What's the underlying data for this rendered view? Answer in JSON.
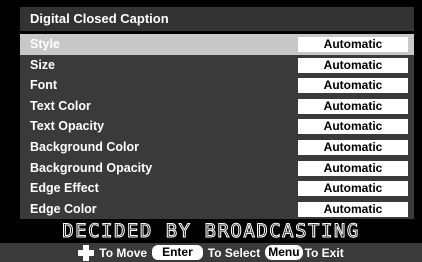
{
  "title": "Digital Closed Caption",
  "menu": {
    "items": [
      {
        "label": "Style",
        "value": "Automatic"
      },
      {
        "label": "Size",
        "value": "Automatic"
      },
      {
        "label": "Font",
        "value": "Automatic"
      },
      {
        "label": "Text Color",
        "value": "Automatic"
      },
      {
        "label": "Text Opacity",
        "value": "Automatic"
      },
      {
        "label": "Background Color",
        "value": "Automatic"
      },
      {
        "label": "Background Opacity",
        "value": "Automatic"
      },
      {
        "label": "Edge Effect",
        "value": "Automatic"
      },
      {
        "label": "Edge Color",
        "value": "Automatic"
      }
    ]
  },
  "banner": "DECIDED BY BROADCASTING",
  "hints": {
    "move_icon": "dpad-icon",
    "move_label": "To Move",
    "enter_key": "Enter",
    "select_label": "To Select",
    "menu_key": "Menu",
    "exit_label": "To Exit"
  },
  "colors": {
    "background": "#000000",
    "panel": "#3a3a3a",
    "selected_row": "#c8c8c8",
    "value_box": "#ffffff"
  }
}
